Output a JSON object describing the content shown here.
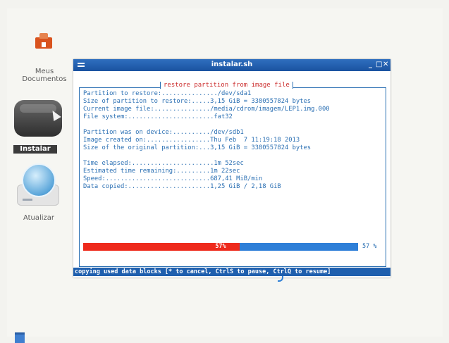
{
  "desktop": {
    "icons": [
      {
        "label": "Meus\nDocumentos"
      },
      {
        "label": "Instalar"
      },
      {
        "label": "Atualizar"
      }
    ]
  },
  "window": {
    "title": "instalar.sh",
    "controls": {
      "minimize": "_",
      "maximize": "□",
      "close": "✕"
    }
  },
  "dialog": {
    "title": "restore partition from image file",
    "lines": [
      "Partition to restore:.............../dev/sda1",
      "Size of partition to restore:.....3,15 GiB = 3380557824 bytes",
      "Current image file:.............../media/cdrom/imagem/LEP1.img.000",
      "File system:.......................fat32",
      "Partition was on device:........../dev/sdb1",
      "Image created on:.................Thu Feb  7 11:19:18 2013",
      "Size of the original partition:...3,15 GiB = 3380557824 bytes",
      "Time elapsed:......................1m 52sec",
      "Estimated time remaining:.........1m 22sec",
      "Speed:............................687,41 MiB/min",
      "Data copied:......................1,25 GiB / 2,18 GiB"
    ],
    "progress": {
      "fraction": 0.57,
      "inner_label": "57%",
      "side_label": "57 %"
    }
  },
  "statusbar": {
    "text": "copying used data blocks [* to cancel, CtrlS to pause, CtrlQ to resume]"
  },
  "colors": {
    "titlebar": "#1f5fae",
    "progress_fill": "#ee2a1c",
    "progress_track": "#2e7fd8",
    "terminal_text": "#2a6fb3"
  }
}
